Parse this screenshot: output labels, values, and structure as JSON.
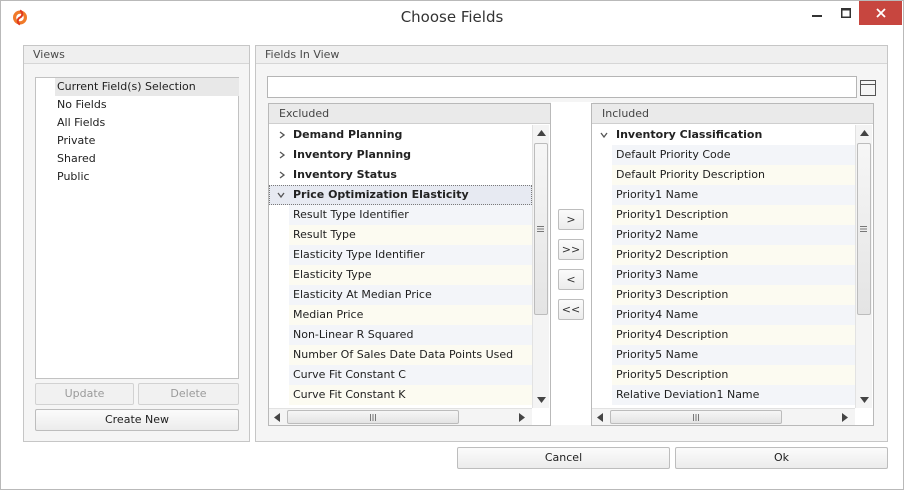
{
  "window": {
    "title": "Choose Fields",
    "icon": "app-logo-icon",
    "controls": [
      "minimize-icon",
      "maximize-icon",
      "close-icon"
    ],
    "close_color": "#c7463f"
  },
  "views": {
    "header": "Views",
    "items": [
      "Current Field(s) Selection",
      "No Fields",
      "All Fields",
      "Private",
      "Shared",
      "Public"
    ],
    "selected_index": 0,
    "update_label": "Update",
    "delete_label": "Delete",
    "create_label": "Create New"
  },
  "fields_in_view": {
    "header": "Fields In View",
    "search_value": "",
    "excluded": {
      "header": "Excluded",
      "categories": [
        {
          "label": "Demand Planning",
          "expanded": false
        },
        {
          "label": "Inventory Planning",
          "expanded": false
        },
        {
          "label": "Inventory Status",
          "expanded": false
        },
        {
          "label": "Price Optimization Elasticity",
          "expanded": true
        }
      ],
      "fields": [
        "Result Type Identifier",
        "Result Type",
        "Elasticity Type Identifier",
        "Elasticity Type",
        "Elasticity At Median Price",
        "Median Price",
        "Non-Linear R Squared",
        "Number Of Sales Date Data Points Used",
        "Curve Fit Constant C",
        "Curve Fit Constant K"
      ]
    },
    "move_buttons": {
      "add": ">",
      "add_all": ">>",
      "remove": "<",
      "remove_all": "<<"
    },
    "included": {
      "header": "Included",
      "category": "Inventory Classification",
      "fields": [
        "Default Priority Code",
        "Default Priority Description",
        "Priority1 Name",
        "Priority1 Description",
        "Priority2 Name",
        "Priority2 Description",
        "Priority3 Name",
        "Priority3 Description",
        "Priority4 Name",
        "Priority4 Description",
        "Priority5 Name",
        "Priority5 Description",
        "Relative Deviation1 Name"
      ]
    }
  },
  "footer": {
    "cancel_label": "Cancel",
    "ok_label": "Ok"
  }
}
